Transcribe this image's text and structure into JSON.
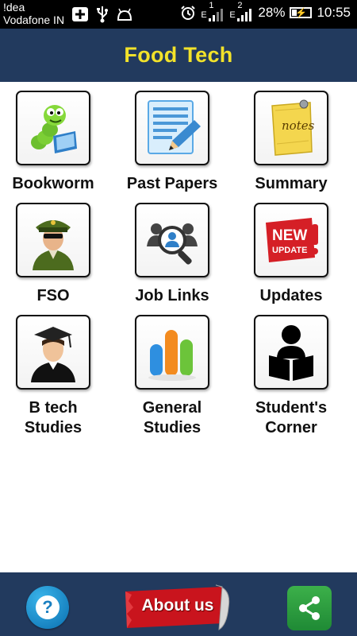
{
  "status_bar": {
    "carrier_line1": "!dea",
    "carrier_line2": "Vodafone IN",
    "sim1_label": "1",
    "sim2_label": "2",
    "network_type": "E",
    "battery_percent": "28%",
    "time": "10:55",
    "icons": [
      "add-notification-icon",
      "usb-icon",
      "android-debug-icon",
      "alarm-icon",
      "signal-icon",
      "battery-charging-icon"
    ]
  },
  "app_bar": {
    "title": "Food Tech"
  },
  "grid": {
    "items": [
      {
        "label": "Bookworm",
        "icon": "bookworm-icon"
      },
      {
        "label": "Past Papers",
        "icon": "past-papers-icon"
      },
      {
        "label": "Summary",
        "icon": "notes-icon"
      },
      {
        "label": "FSO",
        "icon": "officer-icon"
      },
      {
        "label": "Job Links",
        "icon": "job-search-icon"
      },
      {
        "label": "Updates",
        "icon": "new-update-icon"
      },
      {
        "label": "B tech\nStudies",
        "icon": "graduate-icon"
      },
      {
        "label": "General\nStudies",
        "icon": "bar-chart-icon"
      },
      {
        "label": "Student's\nCorner",
        "icon": "student-reading-icon"
      }
    ]
  },
  "bottom_bar": {
    "help_label": "?",
    "about_label": "About us",
    "share_icon": "share-icon"
  },
  "icon_text": {
    "notes": "notes",
    "new": "NEW",
    "update": "UPDATE"
  },
  "colors": {
    "app_bar_bg": "#223a5e",
    "title_color": "#f2e22a",
    "help_blue": "#1a8fd0",
    "share_green": "#2ea043",
    "about_red": "#c0131b"
  }
}
